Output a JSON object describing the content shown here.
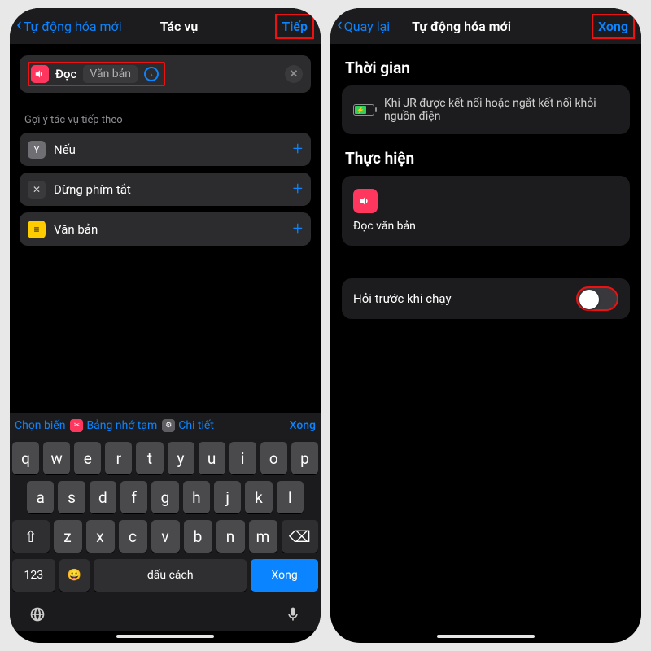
{
  "left": {
    "nav": {
      "back": "Tự động hóa mới",
      "title": "Tác vụ",
      "action": "Tiếp"
    },
    "action": {
      "speak_label": "Đọc",
      "text_token": "Văn bản"
    },
    "suggestions_header": "Gợi ý tác vụ tiếp theo",
    "suggestions": [
      {
        "icon": "Y",
        "label": "Nếu",
        "style": "gray"
      },
      {
        "icon": "✕",
        "label": "Dừng phím tắt",
        "style": "dark"
      },
      {
        "icon": "≡",
        "label": "Văn bản",
        "style": "yellow"
      }
    ],
    "keyboard_bar": {
      "choose_var": "Chọn biến",
      "clipboard": "Bảng nhớ tạm",
      "details": "Chi tiết",
      "done": "Xong"
    },
    "keyboard": {
      "rows": [
        [
          "q",
          "w",
          "e",
          "r",
          "t",
          "y",
          "u",
          "i",
          "o",
          "p"
        ],
        [
          "a",
          "s",
          "d",
          "f",
          "g",
          "h",
          "j",
          "k",
          "l"
        ],
        [
          "z",
          "x",
          "c",
          "v",
          "b",
          "n",
          "m"
        ]
      ],
      "numkey": "123",
      "emoji": "😀",
      "space": "dấu cách",
      "return": "Xong"
    }
  },
  "right": {
    "nav": {
      "back": "Quay lại",
      "title": "Tự động hóa mới",
      "action": "Xong"
    },
    "time_header": "Thời gian",
    "trigger_text": "Khi JR được kết nối hoặc ngắt kết nối khỏi nguồn điện",
    "exec_header": "Thực hiện",
    "exec_label": "Đọc văn bản",
    "ask_label": "Hỏi trước khi chạy"
  }
}
